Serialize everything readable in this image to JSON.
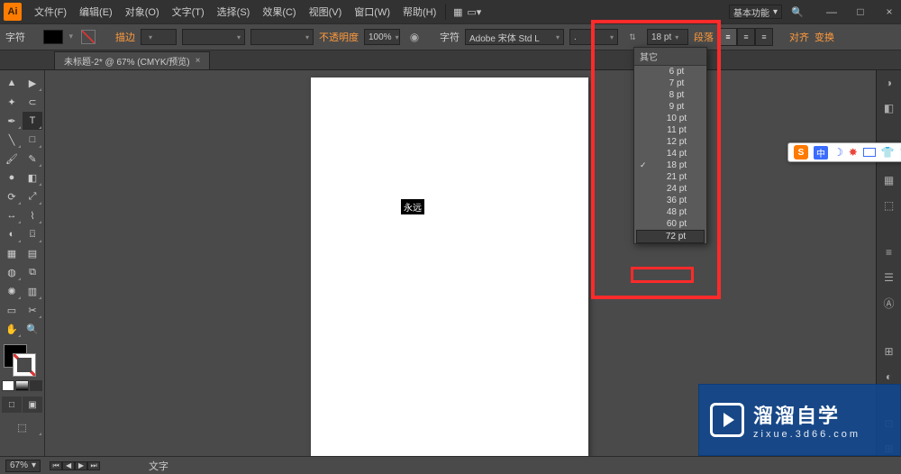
{
  "titlebar": {
    "logo_text": "Ai",
    "menu": [
      "文件(F)",
      "编辑(E)",
      "对象(O)",
      "文字(T)",
      "选择(S)",
      "效果(C)",
      "视图(V)",
      "窗口(W)",
      "帮助(H)"
    ],
    "workspace_label": "基本功能",
    "minimize": "—",
    "maximize": "□",
    "close": "×"
  },
  "controlbar": {
    "char_label": "字符",
    "stroke_label": "描边",
    "opacity_label": "不透明度",
    "opacity_value": "100%",
    "font_panel_label": "字符",
    "font_family": "Adobe 宋体 Std L",
    "font_style": ".",
    "font_size": "18 pt",
    "paragraph_link": "段落",
    "align_link": "对齐",
    "transform_link": "变换",
    "stroke_weight": ""
  },
  "doctab": {
    "name": "未标题-2* @ 67% (CMYK/预览)",
    "close": "×"
  },
  "canvas": {
    "sample_text": "永远"
  },
  "dropdown": {
    "header": "其它",
    "options": [
      "6 pt",
      "7 pt",
      "8 pt",
      "9 pt",
      "10 pt",
      "11 pt",
      "12 pt",
      "14 pt",
      "18 pt",
      "21 pt",
      "24 pt",
      "36 pt",
      "48 pt",
      "60 pt",
      "72 pt"
    ],
    "selected_index": 8,
    "hover_index": 14
  },
  "statusbar": {
    "zoom": "67%",
    "tool_label": "文字"
  },
  "ime": {
    "cn_label": "中"
  },
  "watermark": {
    "brand": "溜溜自学",
    "url": "zixue.3d66.com"
  },
  "tool_icons": {
    "selection": "▲",
    "direct": "▶",
    "wand": "✦",
    "lasso": "⊂",
    "pen": "✒",
    "type": "T",
    "line": "╲",
    "rect": "□",
    "brush": "🖌",
    "pencil": "✎",
    "blob": "●",
    "eraser": "◧",
    "rotate": "⟳",
    "scale": "⤢",
    "width": "↔",
    "warp": "⌇",
    "shapeb": "◐",
    "mesh": "▦",
    "gradient": "▤",
    "eyedrop": "◍",
    "blend": "⧉",
    "symbol": "✺",
    "graph": "▥",
    "artb": "▭",
    "slice": "✂",
    "hand": "✋",
    "zoom": "🔍",
    "print": "⌼",
    "screen": "⬚",
    "search": "🔍",
    "modeA": "□",
    "modeB": "▣"
  },
  "right_icons": [
    "◑",
    "◧",
    "▤",
    "▦",
    "⬚",
    "≡",
    "☰",
    "Ⓐ",
    "⊞",
    "◐",
    "⊡",
    "⊞",
    "⬒"
  ]
}
